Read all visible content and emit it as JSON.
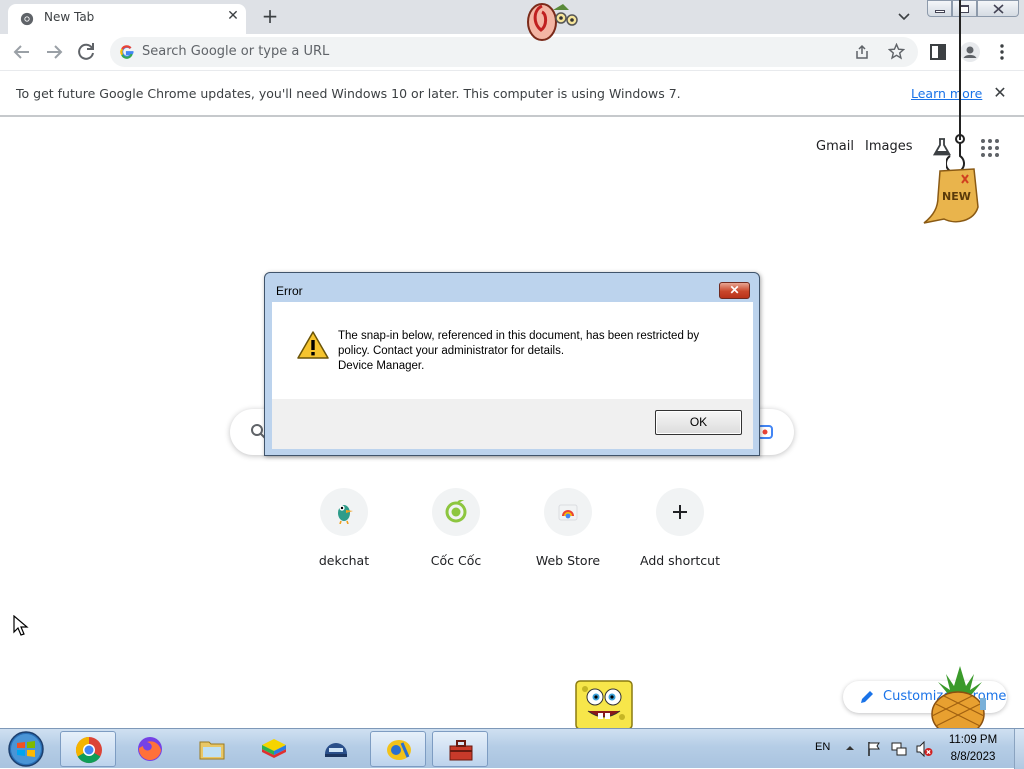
{
  "browser": {
    "tab": {
      "title": "New Tab",
      "close_glyph": "✕"
    },
    "new_tab_glyph": "+",
    "omnibox": {
      "placeholder": "Search Google or type a URL"
    },
    "infobar": {
      "message": "To get future Google Chrome updates, you'll need Windows 10 or later. This computer is using Windows 7.",
      "link": "Learn more",
      "close_glyph": "✕"
    }
  },
  "ntp": {
    "header_links": {
      "gmail": "Gmail",
      "images": "Images"
    },
    "shortcuts": [
      {
        "label": "dekchat",
        "icon": "dekchat-icon"
      },
      {
        "label": "Cốc Cốc",
        "icon": "coccoc-icon"
      },
      {
        "label": "Web Store",
        "icon": "webstore-icon"
      },
      {
        "label": "Add shortcut",
        "icon": "plus-icon"
      }
    ],
    "customize_label": "Customize Chrome",
    "decorations": {
      "new_sign_text": "NEW"
    }
  },
  "dialog": {
    "title": "Error",
    "close_glyph": "✕",
    "message": "The snap-in below, referenced in this document, has been restricted by\npolicy. Contact your administrator for details.\nDevice Manager.",
    "ok_label": "OK"
  },
  "taskbar": {
    "apps": [
      "chrome",
      "firefox",
      "file-explorer",
      "bluestacks",
      "vpn-helmet",
      "ms-media",
      "toolbox"
    ],
    "tray": {
      "lang": "EN",
      "time": "11:09 PM",
      "date": "8/8/2023"
    }
  },
  "colors": {
    "accent": "#1a73e8",
    "dialog_frame": "#bcd3ed",
    "taskbar": "#b5cde6",
    "close_red": "#c9472b"
  }
}
